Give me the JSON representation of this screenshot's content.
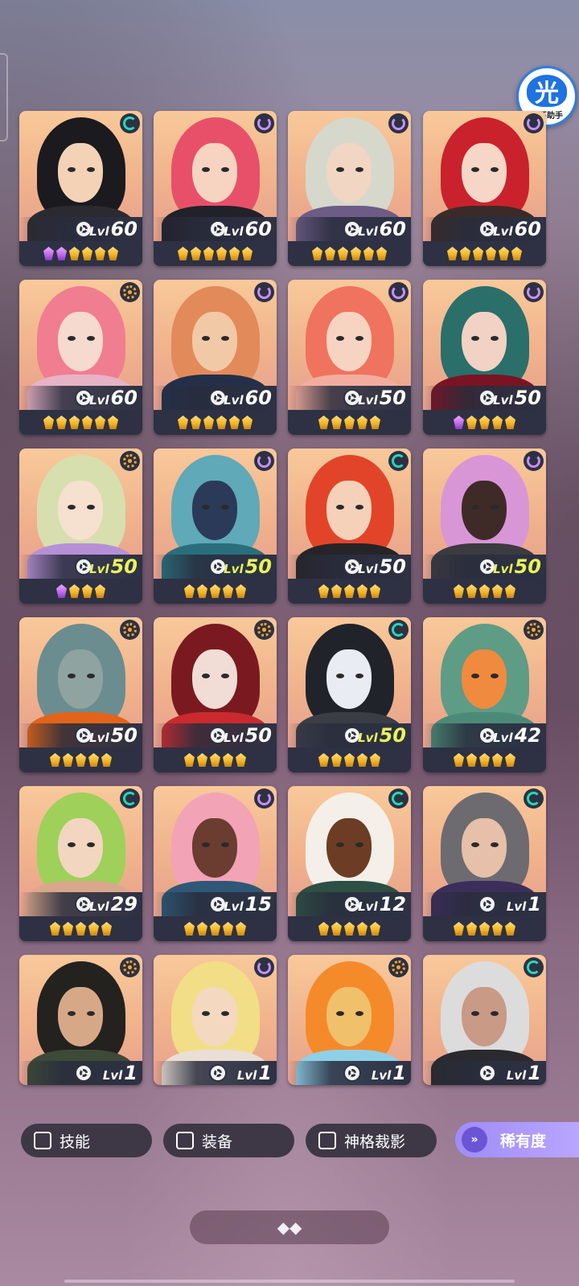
{
  "assist_badge": {
    "glyph": "光",
    "label": "光环助手"
  },
  "heroes": [
    {
      "level": "60",
      "lvl_prefix": "Lvl",
      "element": "teal",
      "stars": 6,
      "purple_stars": 2,
      "palette": {
        "hair": "#1b1a1f",
        "face": "#f3d2b6",
        "body": "#2b2a30"
      }
    },
    {
      "level": "60",
      "lvl_prefix": "Lvl",
      "element": "purple",
      "stars": 6,
      "purple_stars": 0,
      "palette": {
        "hair": "#e8506a",
        "face": "#f7d3c2",
        "body": "#222129"
      }
    },
    {
      "level": "60",
      "lvl_prefix": "Lvl",
      "element": "purple",
      "stars": 6,
      "purple_stars": 0,
      "palette": {
        "hair": "#d6d8cc",
        "face": "#f1d6c4",
        "body": "#6c5c86"
      }
    },
    {
      "level": "60",
      "lvl_prefix": "Lvl",
      "element": "purple",
      "stars": 6,
      "purple_stars": 0,
      "palette": {
        "hair": "#c9222c",
        "face": "#f6d6c6",
        "body": "#3a2b2a"
      }
    },
    {
      "level": "60",
      "lvl_prefix": "Lvl",
      "element": "orange",
      "stars": 6,
      "purple_stars": 0,
      "palette": {
        "hair": "#f17d91",
        "face": "#f6d9cf",
        "body": "#e7b3c6"
      }
    },
    {
      "level": "60",
      "lvl_prefix": "Lvl",
      "element": "purple",
      "stars": 6,
      "purple_stars": 0,
      "palette": {
        "hair": "#e38a5a",
        "face": "#f2c9a6",
        "body": "#243049"
      }
    },
    {
      "level": "50",
      "lvl_prefix": "Lvl",
      "element": "purple",
      "stars": 5,
      "purple_stars": 0,
      "palette": {
        "hair": "#f0735f",
        "face": "#f7d4c2",
        "body": "#f3ad9e"
      }
    },
    {
      "level": "50",
      "lvl_prefix": "Lvl",
      "element": "purple",
      "stars": 5,
      "purple_stars": 1,
      "palette": {
        "hair": "#2a6f6a",
        "face": "#f2d2c4",
        "body": "#7a1424"
      }
    },
    {
      "level": "50",
      "lvl_prefix": "Lvl",
      "element": "orange",
      "stars": 4,
      "purple_stars": 1,
      "gold_level": true,
      "palette": {
        "hair": "#d8dfae",
        "face": "#f6e0d0",
        "body": "#b690d6"
      }
    },
    {
      "level": "50",
      "lvl_prefix": "Lvl",
      "element": "purple",
      "stars": 5,
      "purple_stars": 0,
      "gold_level": true,
      "palette": {
        "hair": "#5fa9b8",
        "face": "#2b3a58",
        "body": "#2a6e7c"
      }
    },
    {
      "level": "50",
      "lvl_prefix": "Lvl",
      "element": "teal",
      "stars": 5,
      "purple_stars": 0,
      "palette": {
        "hair": "#e2442a",
        "face": "#f5d1b9",
        "body": "#262428"
      }
    },
    {
      "level": "50",
      "lvl_prefix": "Lvl",
      "element": "purple",
      "stars": 5,
      "purple_stars": 0,
      "gold_level": true,
      "palette": {
        "hair": "#d996d6",
        "face": "#3e2b28",
        "body": "#3b3b40"
      }
    },
    {
      "level": "50",
      "lvl_prefix": "Lvl",
      "element": "orange",
      "stars": 5,
      "purple_stars": 0,
      "palette": {
        "hair": "#6b8d8f",
        "face": "#8fa3a1",
        "body": "#e1641a"
      }
    },
    {
      "level": "50",
      "lvl_prefix": "Lvl",
      "element": "orange",
      "stars": 5,
      "purple_stars": 0,
      "palette": {
        "hair": "#7a1a20",
        "face": "#f1ddd5",
        "body": "#c92a2e"
      }
    },
    {
      "level": "50",
      "lvl_prefix": "Lvl",
      "element": "teal",
      "stars": 5,
      "purple_stars": 0,
      "gold_level": true,
      "palette": {
        "hair": "#20232a",
        "face": "#e9ecf2",
        "body": "#3a3d46"
      }
    },
    {
      "level": "42",
      "lvl_prefix": "Lvl",
      "element": "orange",
      "stars": 5,
      "purple_stars": 0,
      "palette": {
        "hair": "#5e9c86",
        "face": "#f08a3e",
        "body": "#4c8a78"
      }
    },
    {
      "level": "29",
      "lvl_prefix": "Lvl",
      "element": "teal",
      "stars": 5,
      "purple_stars": 0,
      "palette": {
        "hair": "#9ed05a",
        "face": "#f2d6c0",
        "body": "#d9a78c"
      }
    },
    {
      "level": "15",
      "lvl_prefix": "Lvl",
      "element": "purple",
      "stars": 5,
      "purple_stars": 0,
      "palette": {
        "hair": "#f3a3b6",
        "face": "#6a3d30",
        "body": "#2e5876"
      }
    },
    {
      "level": "12",
      "lvl_prefix": "Lvl",
      "element": "teal",
      "stars": 5,
      "purple_stars": 0,
      "palette": {
        "hair": "#f4efe8",
        "face": "#6c3d24",
        "body": "#2d4f44"
      }
    },
    {
      "level": "1",
      "lvl_prefix": "Lvl",
      "element": "teal",
      "stars": 5,
      "purple_stars": 0,
      "palette": {
        "hair": "#6d6b70",
        "face": "#e6c0a8",
        "body": "#3c2e5a"
      }
    },
    {
      "level": "1",
      "lvl_prefix": "Lvl",
      "element": "orange",
      "stars": 0,
      "purple_stars": 0,
      "palette": {
        "hair": "#23221f",
        "face": "#d7a888",
        "body": "#3e4a38"
      }
    },
    {
      "level": "1",
      "lvl_prefix": "Lvl",
      "element": "purple",
      "stars": 0,
      "purple_stars": 0,
      "palette": {
        "hair": "#f2de86",
        "face": "#f4d8c0",
        "body": "#e9dfd6"
      }
    },
    {
      "level": "1",
      "lvl_prefix": "Lvl",
      "element": "orange",
      "stars": 0,
      "purple_stars": 0,
      "palette": {
        "hair": "#f58a2a",
        "face": "#f0c06a",
        "body": "#8fd0e8"
      }
    },
    {
      "level": "1",
      "lvl_prefix": "Lvl",
      "element": "teal",
      "stars": 0,
      "purple_stars": 0,
      "palette": {
        "hair": "#dcdcdc",
        "face": "#c99a86",
        "body": "#2a2a2e"
      }
    }
  ],
  "filters": {
    "skill": "技能",
    "equipment": "装备",
    "divine_shadow": "神格裁影",
    "rarity": "稀有度",
    "rarity_icon": "»"
  },
  "expand_button": {
    "glyph": "◆◆"
  }
}
